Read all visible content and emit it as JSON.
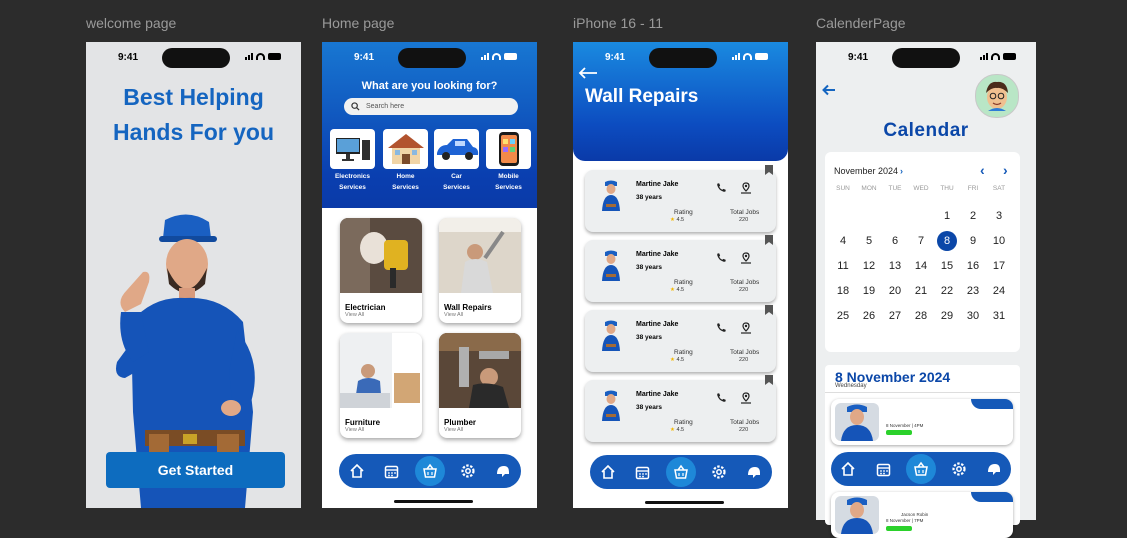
{
  "frames": {
    "welcome_label": "welcome page",
    "home_label": "Home page",
    "iphone_label": "iPhone 16 - 11",
    "calendar_label": "CalenderPage"
  },
  "status_time": "9:41",
  "welcome": {
    "title_line1": "Best Helping",
    "title_line2": "Hands For you",
    "cta": "Get Started"
  },
  "home": {
    "question": "What are you looking for?",
    "search_placeholder": "Search here",
    "categories": [
      {
        "line1": "Electronics",
        "line2": "Services"
      },
      {
        "line1": "Home",
        "line2": "Services"
      },
      {
        "line1": "Car",
        "line2": "Services"
      },
      {
        "line1": "Mobile",
        "line2": "Services"
      }
    ],
    "services": [
      {
        "name": "Electrician",
        "sub": "View All"
      },
      {
        "name": "Wall Repairs",
        "sub": "View All"
      },
      {
        "name": "Furniture",
        "sub": "View All"
      },
      {
        "name": "Plumber",
        "sub": "View All"
      }
    ]
  },
  "wall_repairs": {
    "title": "Wall Repairs",
    "back_icon": "arrow-left",
    "workers": [
      {
        "name": "Martine Jake",
        "age": "38 years",
        "rating_label": "Rating",
        "rating": "4.5",
        "jobs_label": "Total Jobs",
        "jobs": "220"
      },
      {
        "name": "Martine Jake",
        "age": "38 years",
        "rating_label": "Rating",
        "rating": "4.5",
        "jobs_label": "Total Jobs",
        "jobs": "220"
      },
      {
        "name": "Martine Jake",
        "age": "38 years",
        "rating_label": "Rating",
        "rating": "4.5",
        "jobs_label": "Total Jobs",
        "jobs": "220"
      },
      {
        "name": "Martine Jake",
        "age": "38 years",
        "rating_label": "Rating",
        "rating": "4.5",
        "jobs_label": "Total Jobs",
        "jobs": "220"
      }
    ]
  },
  "calendar": {
    "title": "Calendar",
    "month": "November 2024",
    "month_chevron": "›",
    "prev": "‹",
    "next": "›",
    "dow": [
      "SUN",
      "MON",
      "TUE",
      "WED",
      "THU",
      "FRI",
      "SAT"
    ],
    "days": [
      "",
      "",
      "",
      "",
      "1",
      "2",
      "3",
      "4",
      "5",
      "6",
      "7",
      "8",
      "9",
      "10",
      "11",
      "12",
      "13",
      "14",
      "15",
      "16",
      "17",
      "18",
      "19",
      "20",
      "21",
      "22",
      "23",
      "24",
      "25",
      "26",
      "27",
      "28",
      "29",
      "30",
      "31"
    ],
    "selected_day": "8",
    "event_date": "8 November 2024",
    "event_weekday": "Wednesday",
    "events": [
      {
        "person": "",
        "time": "8 November | 4PM"
      },
      {
        "person": "Jacson Robin",
        "time": "8 November | 7PM"
      }
    ]
  },
  "nav_icons": [
    "home-icon",
    "calendar-icon",
    "basket-icon",
    "settings-icon",
    "helmet-icon"
  ],
  "colors": {
    "primary": "#0b47a8",
    "accent": "#1e88d8",
    "cta": "#0d6cbf",
    "background": "#2c2c2c"
  }
}
